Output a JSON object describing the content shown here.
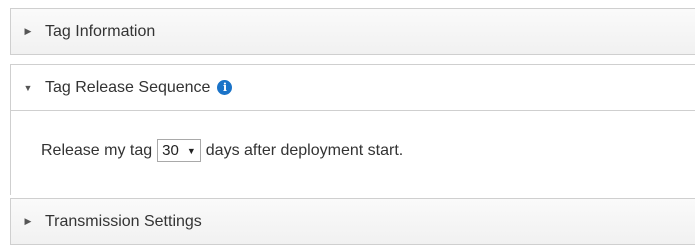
{
  "sections": [
    {
      "label": "Tag Information",
      "state": "collapsed"
    },
    {
      "label": "Tag Release Sequence",
      "state": "expanded",
      "info_icon": "info-circle-icon"
    },
    {
      "label": "Transmission Settings",
      "state": "collapsed"
    }
  ],
  "release": {
    "prefix": "Release my tag",
    "selected_days": "30",
    "suffix": "days after deployment start."
  },
  "colors": {
    "info_icon": "#1a73c8",
    "border": "#cfcfcf",
    "text": "#333333"
  }
}
